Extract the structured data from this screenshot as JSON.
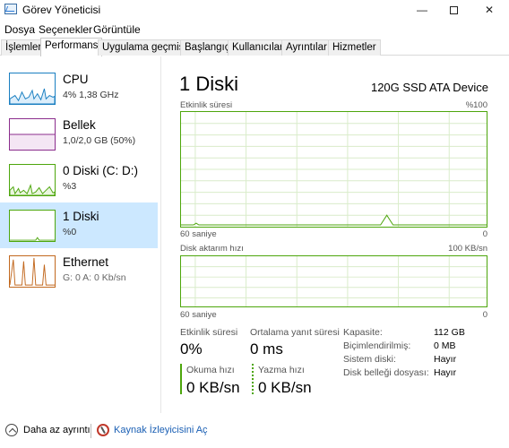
{
  "window": {
    "title": "Görev Yöneticisi",
    "minimize": "—",
    "close": "✕"
  },
  "menu": [
    "Dosya",
    "Seçenekler",
    "Görüntüle"
  ],
  "tabs": [
    "İşlemler",
    "Performans",
    "Uygulama geçmişi",
    "Başlangıç",
    "Kullanıcılar",
    "Ayrıntılar",
    "Hizmetler"
  ],
  "sidebar": [
    {
      "name": "CPU",
      "sub": "4% 1,38 GHz",
      "color": "#1a7fc1",
      "fill": "#dceefb"
    },
    {
      "name": "Bellek",
      "sub": "1,0/2,0 GB (50%)",
      "color": "#8b2d8d",
      "fill": "#f4e6f4"
    },
    {
      "name": "0 Diski (C: D:)",
      "sub": "%3",
      "color": "#4da60c",
      "fill": "#eaf6df"
    },
    {
      "name": "1 Diski",
      "sub": "%0",
      "color": "#4da60c",
      "fill": "#eaf6df"
    },
    {
      "name": "Ethernet",
      "sub": "G: 0 A: 0 Kb/sn",
      "color": "#c2681e",
      "fill": "#fbeee3"
    }
  ],
  "main": {
    "title": "1 Diski",
    "device": "120G SSD ATA Device",
    "graph1": {
      "label": "Etkinlik süresi",
      "max": "%100",
      "time": "60 saniye",
      "min": "0"
    },
    "graph2": {
      "label": "Disk aktarım hızı",
      "max": "100 KB/sn",
      "time": "60 saniye",
      "min": "0"
    },
    "stats": {
      "activity_label": "Etkinlik süresi",
      "activity_value": "0%",
      "response_label": "Ortalama yanıt süresi",
      "response_value": "0 ms",
      "read_label": "Okuma hızı",
      "read_value": "0 KB/sn",
      "write_label": "Yazma hızı",
      "write_value": "0 KB/sn"
    },
    "props": [
      {
        "key": "Kapasite:",
        "value": "112 GB"
      },
      {
        "key": "Biçimlendirilmiş:",
        "value": "0 MB"
      },
      {
        "key": "Sistem diski:",
        "value": "Hayır"
      },
      {
        "key": "Disk belleği dosyası:",
        "value": "Hayır"
      }
    ]
  },
  "footer": {
    "less_details": "Daha az ayrıntı",
    "resource_monitor": "Kaynak İzleyicisini Aç"
  }
}
